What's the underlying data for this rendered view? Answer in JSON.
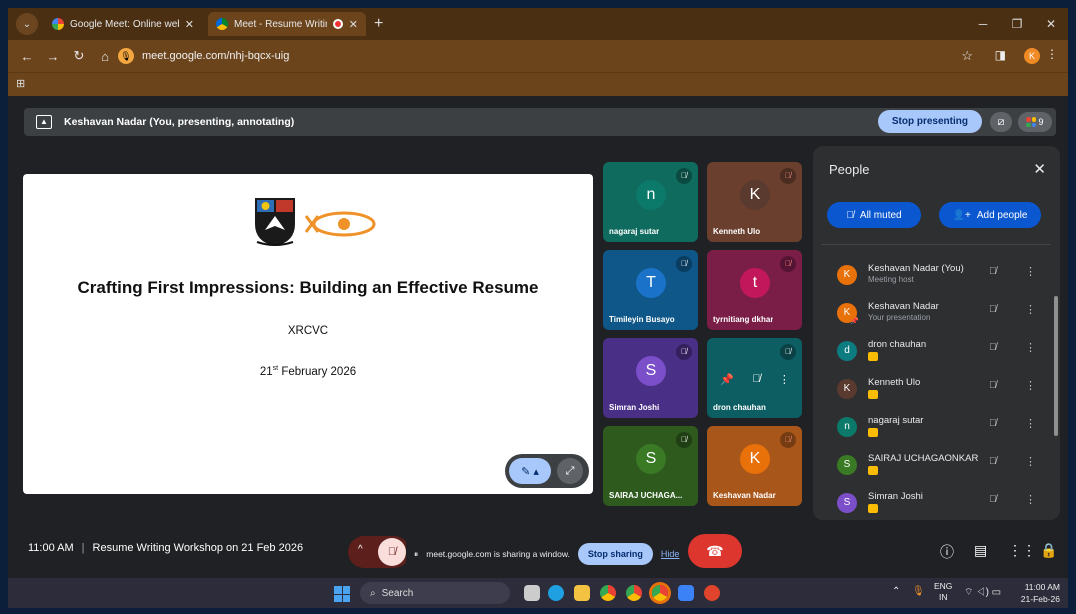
{
  "browser": {
    "tabs": [
      {
        "title": "Google Meet: Online web and v",
        "active": false
      },
      {
        "title": "Meet - Resume Writing Wo",
        "active": true
      }
    ],
    "url": "meet.google.com/nhj-bqcx-uig",
    "profile_initial": "K"
  },
  "presenting_bar": {
    "text": "Keshavan Nadar (You, presenting, annotating)",
    "stop_label": "Stop presenting",
    "participant_count": "9"
  },
  "slide": {
    "title": "Crafting First Impressions: Building an Effective Resume",
    "org": "XRCVC",
    "date_day": "21",
    "date_suffix": "st",
    "date_rest": " February 2026"
  },
  "tiles": [
    {
      "initial": "n",
      "name": "nagaraj sutar",
      "bg": "#0f6b5e",
      "av": "#0b7a6a"
    },
    {
      "initial": "K",
      "name": "Kenneth Ulo",
      "bg": "#6b3f2e",
      "av": "#5a3a2e"
    },
    {
      "initial": "T",
      "name": "Timileyin Busayo",
      "bg": "#0e5788",
      "av": "#1a73c8"
    },
    {
      "initial": "t",
      "name": "tyrnitiang dkhar",
      "bg": "#7a1e48",
      "av": "#c2185b"
    },
    {
      "initial": "S",
      "name": "Simran Joshi",
      "bg": "#4a2f86",
      "av": "#7b4fc9"
    },
    {
      "initial": "d",
      "name": "dron chauhan",
      "bg": "#0d5e63",
      "av": "#0d7c80"
    },
    {
      "initial": "S",
      "name": "SAIRAJ UCHAGA...",
      "bg": "#2e5a1e",
      "av": "#3a7a24"
    },
    {
      "initial": "K",
      "name": "Keshavan Nadar",
      "bg": "#a8561a",
      "av": "#e8710a"
    }
  ],
  "people": {
    "title": "People",
    "all_muted_label": "All muted",
    "add_people_label": "Add people",
    "list": [
      {
        "initial": "K",
        "name": "Keshavan Nadar (You)",
        "sub": "Meeting host",
        "color": "#e8710a"
      },
      {
        "initial": "K",
        "name": "Keshavan Nadar",
        "sub": "Your presentation",
        "color": "#e8710a"
      },
      {
        "initial": "d",
        "name": "dron chauhan",
        "sub": "",
        "color": "#0d7c80"
      },
      {
        "initial": "K",
        "name": "Kenneth Ulo",
        "sub": "",
        "color": "#5a3a2e"
      },
      {
        "initial": "n",
        "name": "nagaraj sutar",
        "sub": "",
        "color": "#0b7a6a"
      },
      {
        "initial": "S",
        "name": "SAIRAJ UCHAGAONKAR",
        "sub": "",
        "color": "#3a7a24"
      },
      {
        "initial": "S",
        "name": "Simran Joshi",
        "sub": "",
        "color": "#7b4fc9"
      }
    ]
  },
  "meeting": {
    "time": "11:00 AM",
    "separator": "|",
    "name": "Resume Writing Workshop on 21 Feb 2026"
  },
  "share_banner": {
    "text": "meet.google.com is sharing a window.",
    "stop_label": "Stop sharing",
    "hide_label": "Hide"
  },
  "taskbar": {
    "search_label": "Search",
    "lang_top": "ENG",
    "lang_bottom": "IN",
    "clock_time": "11:00 AM",
    "clock_date": "21-Feb-26"
  }
}
